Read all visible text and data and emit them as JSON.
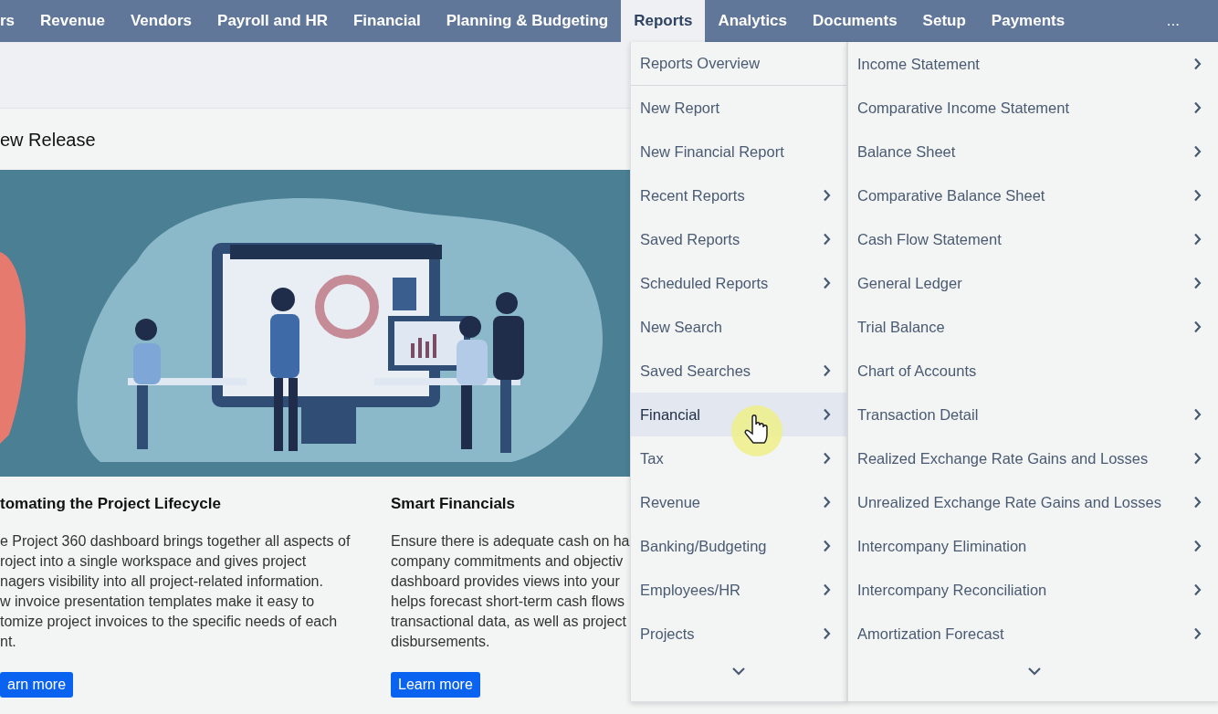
{
  "nav": {
    "items": [
      {
        "label": "rs",
        "selected": false
      },
      {
        "label": "Revenue",
        "selected": false
      },
      {
        "label": "Vendors",
        "selected": false
      },
      {
        "label": "Payroll and HR",
        "selected": false
      },
      {
        "label": "Financial",
        "selected": false
      },
      {
        "label": "Planning & Budgeting",
        "selected": false
      },
      {
        "label": "Reports",
        "selected": true
      },
      {
        "label": "Analytics",
        "selected": false
      },
      {
        "label": "Documents",
        "selected": false
      },
      {
        "label": "Setup",
        "selected": false
      },
      {
        "label": "Payments",
        "selected": false
      }
    ],
    "more": "..."
  },
  "card": {
    "title": "ew Release",
    "features": [
      {
        "title": "tomating the Project Lifecycle",
        "text": "e Project 360 dashboard brings together all aspects of\nroject into a single workspace and gives project\nnagers visibility into all project-related information.\nw invoice presentation templates make it easy to\ntomize project invoices to the specific needs of each\nnt.",
        "button": "arn more"
      },
      {
        "title": "Smart Financials",
        "text": "Ensure there is adequate cash on ha\ncompany commitments and objectiv\ndashboard provides views into your\nhelps forecast short-term cash flows\ntransactional data, as well as project\ndisbursements.",
        "button": "Learn more"
      }
    ]
  },
  "menu": {
    "items": [
      {
        "label": "Reports Overview",
        "submenu": false,
        "selected": false,
        "divider": true
      },
      {
        "label": "New Report",
        "submenu": false,
        "selected": false,
        "divider": false
      },
      {
        "label": "New Financial Report",
        "submenu": false,
        "selected": false,
        "divider": false
      },
      {
        "label": "Recent Reports",
        "submenu": true,
        "selected": false,
        "divider": false
      },
      {
        "label": "Saved Reports",
        "submenu": true,
        "selected": false,
        "divider": false
      },
      {
        "label": "Scheduled Reports",
        "submenu": true,
        "selected": false,
        "divider": false
      },
      {
        "label": "New Search",
        "submenu": false,
        "selected": false,
        "divider": false
      },
      {
        "label": "Saved Searches",
        "submenu": true,
        "selected": false,
        "divider": false
      },
      {
        "label": "Financial",
        "submenu": true,
        "selected": true,
        "divider": false
      },
      {
        "label": "Tax",
        "submenu": true,
        "selected": false,
        "divider": false
      },
      {
        "label": "Revenue",
        "submenu": true,
        "selected": false,
        "divider": false
      },
      {
        "label": "Banking/Budgeting",
        "submenu": true,
        "selected": false,
        "divider": false
      },
      {
        "label": "Employees/HR",
        "submenu": true,
        "selected": false,
        "divider": false
      },
      {
        "label": "Projects",
        "submenu": true,
        "selected": false,
        "divider": false
      }
    ]
  },
  "submenu": {
    "items": [
      {
        "label": "Income Statement",
        "submenu": true
      },
      {
        "label": "Comparative Income Statement",
        "submenu": true
      },
      {
        "label": "Balance Sheet",
        "submenu": true
      },
      {
        "label": "Comparative Balance Sheet",
        "submenu": true
      },
      {
        "label": "Cash Flow Statement",
        "submenu": true
      },
      {
        "label": "General Ledger",
        "submenu": true
      },
      {
        "label": "Trial Balance",
        "submenu": true
      },
      {
        "label": "Chart of Accounts",
        "submenu": false
      },
      {
        "label": "Transaction Detail",
        "submenu": true
      },
      {
        "label": "Realized Exchange Rate Gains and Losses",
        "submenu": true
      },
      {
        "label": "Unrealized Exchange Rate Gains and Losses",
        "submenu": true
      },
      {
        "label": "Intercompany Elimination",
        "submenu": true
      },
      {
        "label": "Intercompany Reconciliation",
        "submenu": true
      },
      {
        "label": "Amortization Forecast",
        "submenu": true
      }
    ]
  }
}
